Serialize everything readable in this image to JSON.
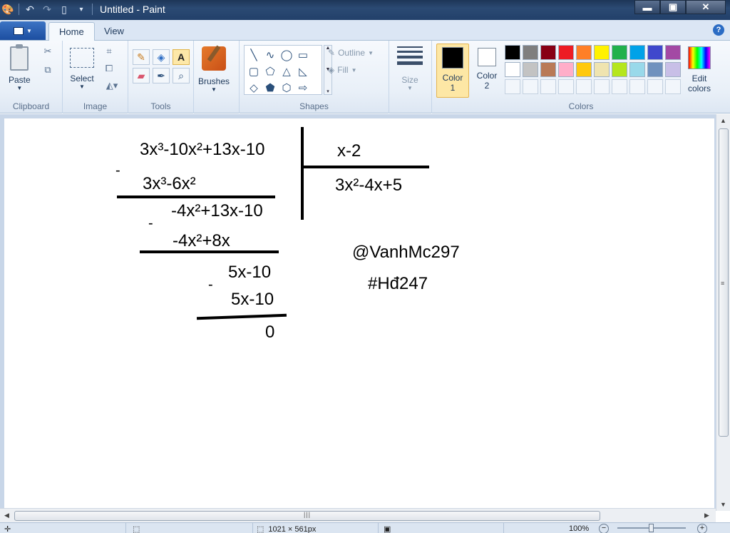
{
  "window": {
    "title": "Untitled - Paint",
    "controls": {
      "minimize": "▬",
      "maximize": "▣",
      "close": "✕"
    }
  },
  "tabs": {
    "home": "Home",
    "view": "View",
    "help": "?"
  },
  "ribbon": {
    "clipboard": {
      "label": "Clipboard",
      "paste": "Paste"
    },
    "image": {
      "label": "Image",
      "select": "Select"
    },
    "tools": {
      "label": "Tools",
      "items": [
        "pencil-icon",
        "fill-icon",
        "text-icon",
        "eraser-icon",
        "color-picker-icon",
        "magnifier-icon"
      ],
      "text_glyph": "A"
    },
    "brushes": {
      "label": "Brushes"
    },
    "shapes": {
      "label": "Shapes",
      "outline": "Outline",
      "fill": "Fill",
      "glyphs": [
        "╲",
        "∿",
        "◯",
        "▭",
        "▢",
        "⬠",
        "△",
        "◺",
        "◇",
        "⬟",
        "⬡",
        "⇨"
      ]
    },
    "size": {
      "label": "Size"
    },
    "colors": {
      "label": "Colors",
      "color1": {
        "line1": "Color",
        "line2": "1",
        "value": "#000000"
      },
      "color2": {
        "line1": "Color",
        "line2": "2",
        "value": "#ffffff"
      },
      "palette_row1": [
        "#000000",
        "#7f7f7f",
        "#880015",
        "#ed1c24",
        "#ff7f27",
        "#fff200",
        "#22b14c",
        "#00a2e8",
        "#3f48cc",
        "#a349a4"
      ],
      "palette_row2": [
        "#ffffff",
        "#c3c3c3",
        "#b97a57",
        "#ffaec9",
        "#ffc90e",
        "#efe4b0",
        "#b5e61d",
        "#99d9ea",
        "#7092be",
        "#c8bfe7"
      ],
      "edit": {
        "line1": "Edit",
        "line2": "colors"
      }
    }
  },
  "canvas": {
    "dividend": "3x³-10x²+13x-10",
    "minus1": "-",
    "sub1": "3x³-6x²",
    "rem1": "-4x²+13x-10",
    "minus2": "-",
    "sub2": "-4x²+8x",
    "rem2": "5x-10",
    "minus3": "-",
    "sub3": "5x-10",
    "result": "0",
    "divisor": "x-2",
    "quotient": "3x²-4x+5",
    "handle": "@VanhMc297",
    "hashtag": "#Hđ247"
  },
  "status": {
    "dimensions": "1021 × 561px",
    "zoom": "100%"
  }
}
